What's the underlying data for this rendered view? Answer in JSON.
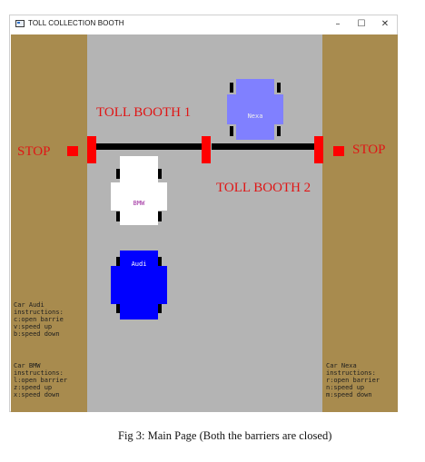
{
  "window": {
    "title": "TOLL COLLECTION BOOTH",
    "minimize_glyph": "–",
    "maximize_glyph": "☐",
    "close_glyph": "✕"
  },
  "scene": {
    "booth1_label": "TOLL BOOTH 1",
    "booth2_label": "TOLL BOOTH 2",
    "stop_left": "STOP",
    "stop_right": "STOP",
    "colors": {
      "road": "#b4b4b4",
      "roadside": "#a88b4e",
      "barrier": "#000000",
      "barrier_post": "#ff0000",
      "label_red": "#e01515"
    },
    "barriers_state": "closed"
  },
  "cars": {
    "nexa": {
      "label": "Nexa",
      "color": "#8080ff"
    },
    "bmw": {
      "label": "BMW",
      "color": "#ffffff"
    },
    "audi": {
      "label": "Audi",
      "color": "#0000ff"
    }
  },
  "instructions": {
    "audi": [
      "Car Audi",
      "instructions:",
      "c:open barrie",
      "v:speed up",
      "b:speed down"
    ],
    "bmw": [
      "Car BMW",
      "instructions:",
      "l:open barrier",
      "z:speed up",
      "x:speed down"
    ],
    "nexa": [
      "Car Nexa",
      "instructions:",
      "r:open barrier",
      "n:speed up",
      "m:speed down"
    ]
  },
  "caption": "Fig 3: Main Page (Both the barriers are closed)"
}
